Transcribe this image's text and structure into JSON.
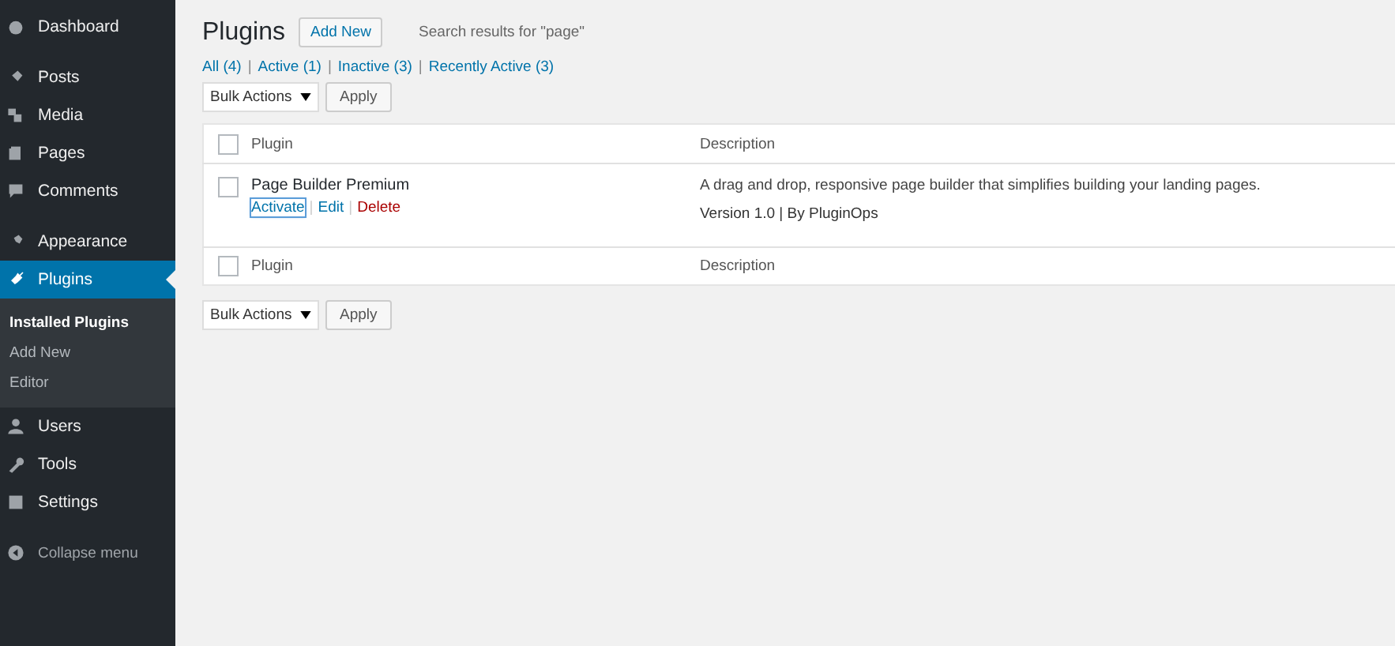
{
  "sidebar": {
    "groups": [
      [
        {
          "label": "Dashboard",
          "selected": false
        }
      ],
      [
        {
          "label": "Posts",
          "selected": false
        },
        {
          "label": "Media",
          "selected": false
        },
        {
          "label": "Pages",
          "selected": false
        },
        {
          "label": "Comments",
          "selected": false
        }
      ],
      [
        {
          "label": "Appearance",
          "selected": false
        },
        {
          "label": "Plugins",
          "selected": true,
          "submenu": [
            {
              "label": "Installed Plugins",
              "selected": true
            },
            {
              "label": "Add New",
              "selected": false
            },
            {
              "label": "Editor",
              "selected": false
            }
          ]
        },
        {
          "label": "Users",
          "selected": false
        },
        {
          "label": "Tools",
          "selected": false
        },
        {
          "label": "Settings",
          "selected": false
        }
      ]
    ],
    "collapse": "Collapse menu"
  },
  "header": {
    "title": "Plugins",
    "add_new": "Add New",
    "search_note": "Search results for \"page\""
  },
  "filters": [
    {
      "label": "All",
      "count": "(4)"
    },
    {
      "divider": "|",
      "label": "Active",
      "count": "(1)"
    },
    {
      "divider": "|",
      "label": "Inactive",
      "count": "(3)"
    },
    {
      "divider": "|",
      "label": "Recently Active",
      "count": "(3)"
    }
  ],
  "bulk_top": {
    "select": "Bulk Actions",
    "button": "Apply"
  },
  "table": {
    "header_checked": false,
    "columns": [
      "Plugin",
      "Description"
    ],
    "rows": [
      {
        "checked": false,
        "name": "Page Builder Premium",
        "actions": [
          {
            "label": "Activate",
            "kind": "link",
            "focused": true
          },
          {
            "divider": "|",
            "label": "Edit",
            "kind": "link",
            "focused": false
          },
          {
            "divider": "|",
            "label": "Delete",
            "kind": "delete",
            "focused": false
          }
        ],
        "description": "A drag and drop, responsive page builder that simplifies building your landing pages.",
        "meta": "Version 1.0 | By PluginOps"
      }
    ],
    "footer_checked": false,
    "footer_columns": [
      "Plugin",
      "Description"
    ]
  },
  "bulk_bottom": {
    "select": "Bulk Actions",
    "button": "Apply"
  }
}
